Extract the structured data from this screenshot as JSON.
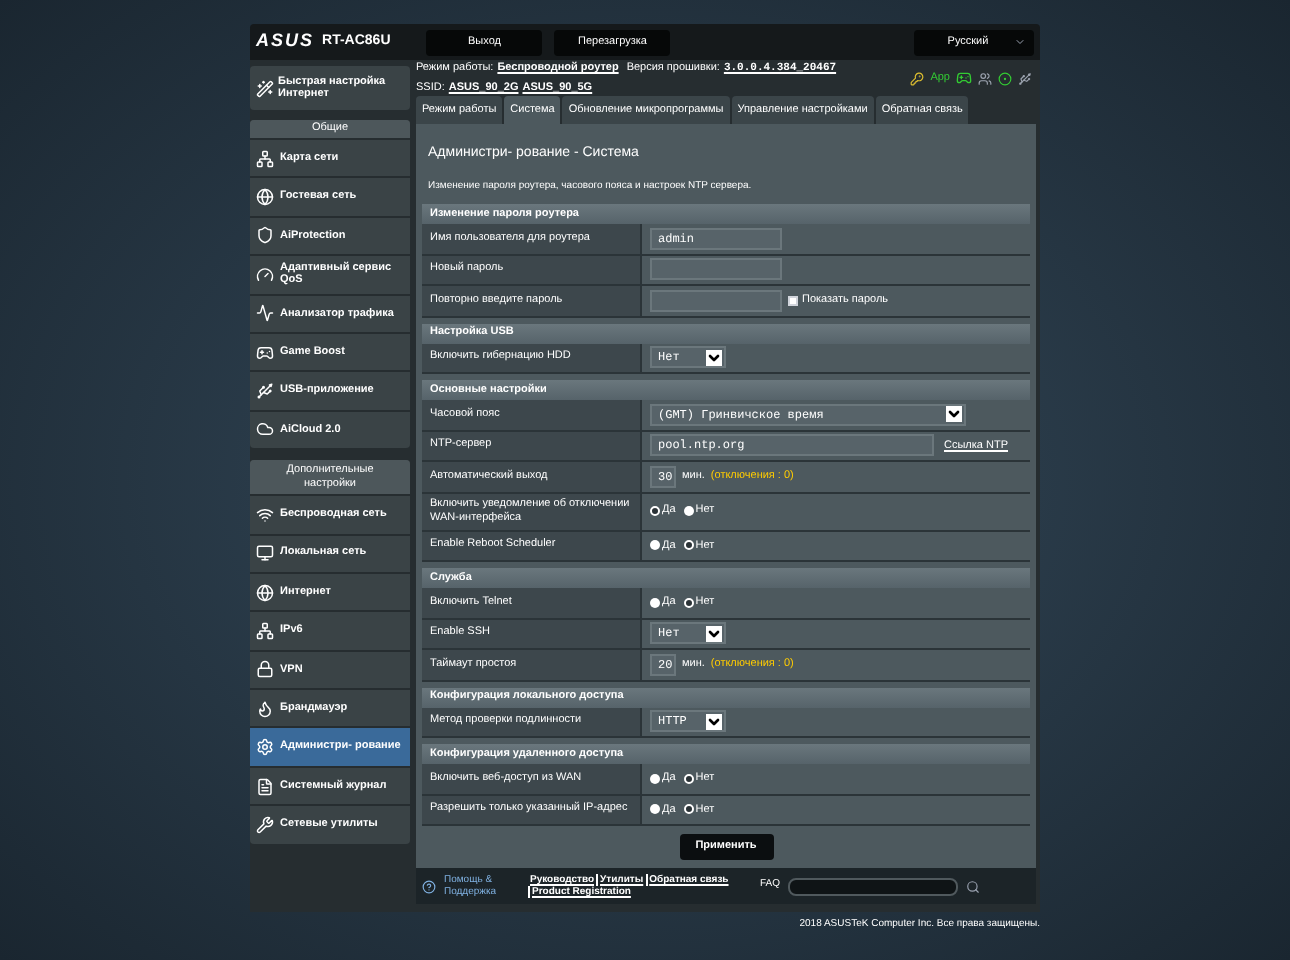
{
  "header": {
    "logo": "ASUS",
    "model": "RT-AC86U",
    "buttons": [
      "Выход",
      "Перезагрузка"
    ],
    "language": "Русский"
  },
  "status": {
    "mode_label": "Режим работы:",
    "mode": "Беспроводной роутер",
    "firmware_label": "Версия прошивки:",
    "firmware": "3.0.0.4.384_20467",
    "ssid_label": "SSID:",
    "ssids": [
      "ASUS_90_2G",
      "ASUS_90_5G"
    ],
    "app_label": "App"
  },
  "tabs": [
    {
      "label": "Режим работы",
      "selected": false
    },
    {
      "label": "Система",
      "selected": true
    },
    {
      "label": "Обновление микропрограммы",
      "selected": false
    },
    {
      "label": "Управление настройками",
      "selected": false
    },
    {
      "label": "Обратная связь",
      "selected": false
    }
  ],
  "sidebar": {
    "quick_setup": "Быстрая настройка Интернет",
    "groups": [
      {
        "title": "Общие",
        "items": [
          {
            "label": "Карта сети",
            "selected": false
          },
          {
            "label": "Гостевая сеть",
            "selected": false
          },
          {
            "label": "AiProtection",
            "selected": false
          },
          {
            "label": "Адаптивный сервис QoS",
            "selected": false
          },
          {
            "label": "Анализатор трафика",
            "selected": false
          },
          {
            "label": "Game Boost",
            "selected": false
          },
          {
            "label": "USB-приложение",
            "selected": false
          },
          {
            "label": "AiCloud 2.0",
            "selected": false
          }
        ]
      },
      {
        "title": "Дополнительные настройки",
        "items": [
          {
            "label": "Беспроводная сеть",
            "selected": false
          },
          {
            "label": "Локальная сеть",
            "selected": false
          },
          {
            "label": "Интернет",
            "selected": false
          },
          {
            "label": "IPv6",
            "selected": false
          },
          {
            "label": "VPN",
            "selected": false
          },
          {
            "label": "Брандмауэр",
            "selected": false
          },
          {
            "label": "Администри- рование",
            "selected": true
          },
          {
            "label": "Системный журнал",
            "selected": false
          },
          {
            "label": "Сетевые утилиты",
            "selected": false
          }
        ]
      }
    ]
  },
  "page": {
    "title": "Администри- рование - Система",
    "description": "Изменение пароля роутера, часового пояса и настроек NTP сервера.",
    "sections": [
      {
        "title": "Изменение пароля роутера",
        "rows": [
          {
            "label": "Имя пользователя для роутера",
            "kind": "text",
            "value": "admin"
          },
          {
            "label": "Новый пароль",
            "kind": "text"
          },
          {
            "label": "Повторно введите пароль",
            "kind": "text",
            "checkbox": {
              "label": "Показать пароль",
              "checked": false
            }
          }
        ]
      },
      {
        "title": "Настройка USB",
        "rows": [
          {
            "label": "Включить гибернацию HDD",
            "kind": "select",
            "value": "Нет"
          }
        ]
      },
      {
        "title": "Основные настройки",
        "rows": [
          {
            "label": "Часовой пояс",
            "kind": "select",
            "wide": true,
            "value": "(GMT) Гринвичское время"
          },
          {
            "label": "NTP-сервер",
            "kind": "text",
            "wide": true,
            "value": "pool.ntp.org",
            "link": "Ссылка NTP"
          },
          {
            "label": "Автоматический выход",
            "kind": "number",
            "value": "30",
            "unit": "мин.",
            "note": "(отключения : 0)"
          },
          {
            "label": "Включить уведомление об отключении WAN-интерфейса",
            "kind": "radio",
            "options": [
              {
                "label": "Да",
                "selected": false
              },
              {
                "label": "Нет",
                "selected": true
              }
            ]
          },
          {
            "label": "Enable Reboot Scheduler",
            "kind": "radio",
            "options": [
              {
                "label": "Да",
                "selected": true
              },
              {
                "label": "Нет",
                "selected": false
              }
            ]
          }
        ]
      },
      {
        "title": "Служба",
        "rows": [
          {
            "label": "Включить Telnet",
            "kind": "radio",
            "options": [
              {
                "label": "Да",
                "selected": true
              },
              {
                "label": "Нет",
                "selected": false
              }
            ]
          },
          {
            "label": "Enable SSH",
            "kind": "select",
            "value": "Нет"
          },
          {
            "label": "Таймаут простоя",
            "kind": "number",
            "value": "20",
            "unit": "мин.",
            "note": "(отключения : 0)"
          }
        ]
      },
      {
        "title": "Конфигурация локального доступа",
        "rows": [
          {
            "label": "Метод проверки подлинности",
            "kind": "select",
            "value": "HTTP"
          }
        ]
      },
      {
        "title": "Конфигурация удаленного доступа",
        "rows": [
          {
            "label": "Включить веб-доступ из WAN",
            "kind": "radio",
            "options": [
              {
                "label": "Да",
                "selected": true
              },
              {
                "label": "Нет",
                "selected": false
              }
            ]
          },
          {
            "label": "Разрешить только указанный IP-адрес",
            "kind": "radio",
            "options": [
              {
                "label": "Да",
                "selected": true
              },
              {
                "label": "Нет",
                "selected": false
              }
            ]
          }
        ]
      }
    ],
    "apply": "Применить"
  },
  "footer": {
    "help": "Помощь & Поддержка",
    "links": [
      "Руководство",
      "Утилиты",
      "Обратная связь",
      "Product Registration"
    ],
    "faq": "FAQ",
    "copyright": "2018 ASUSTeK Computer Inc. Все права защищены."
  }
}
